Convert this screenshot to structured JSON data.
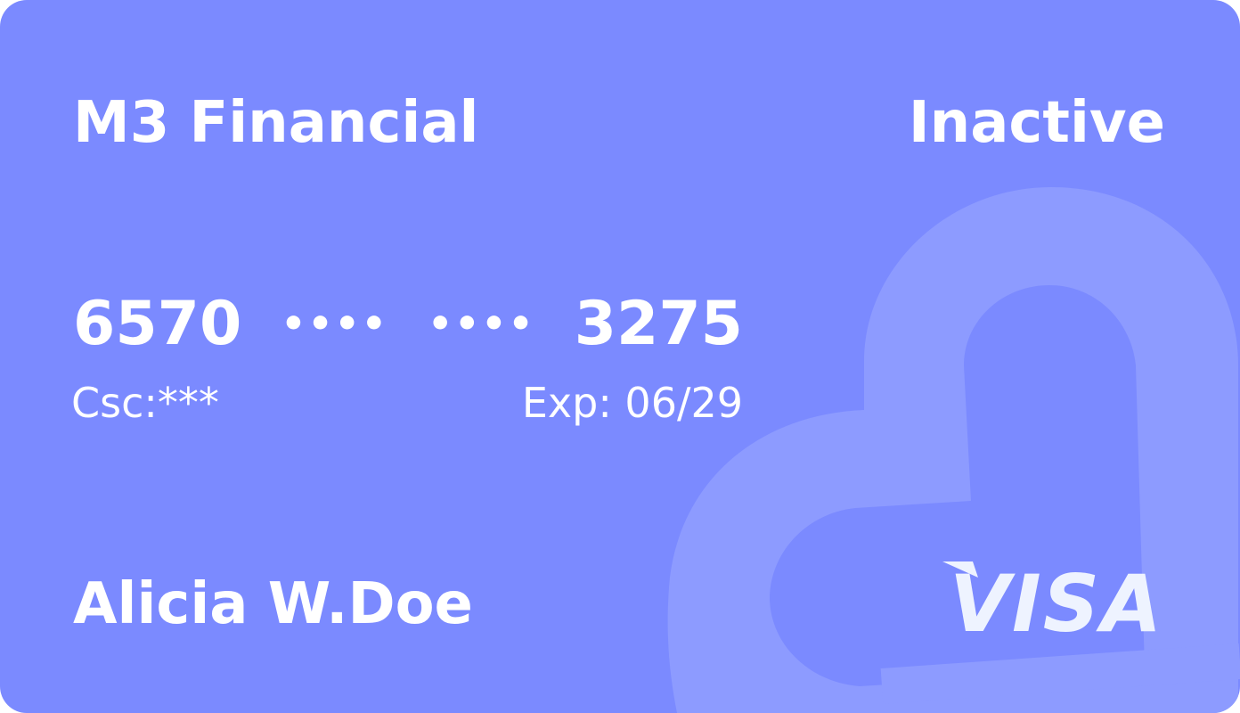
{
  "card": {
    "bank_name": "M3 Financial",
    "status": "Inactive",
    "number": {
      "first_group": "6570",
      "masked_group_1": "••••",
      "masked_group_2": "••••",
      "last_group": "3275"
    },
    "csc_label": "Csc:***",
    "expiry_label": "Exp: 06/29",
    "holder_name": "Alicia W.Doe",
    "brand": "VISA",
    "brand_icon": "visa-logo",
    "background_icon": "m3-watermark-icon"
  },
  "colors": {
    "card_background": "#7b8aff",
    "watermark": "#8d9bff",
    "text": "#ffffff",
    "visa_logo": "#eef3ff"
  }
}
